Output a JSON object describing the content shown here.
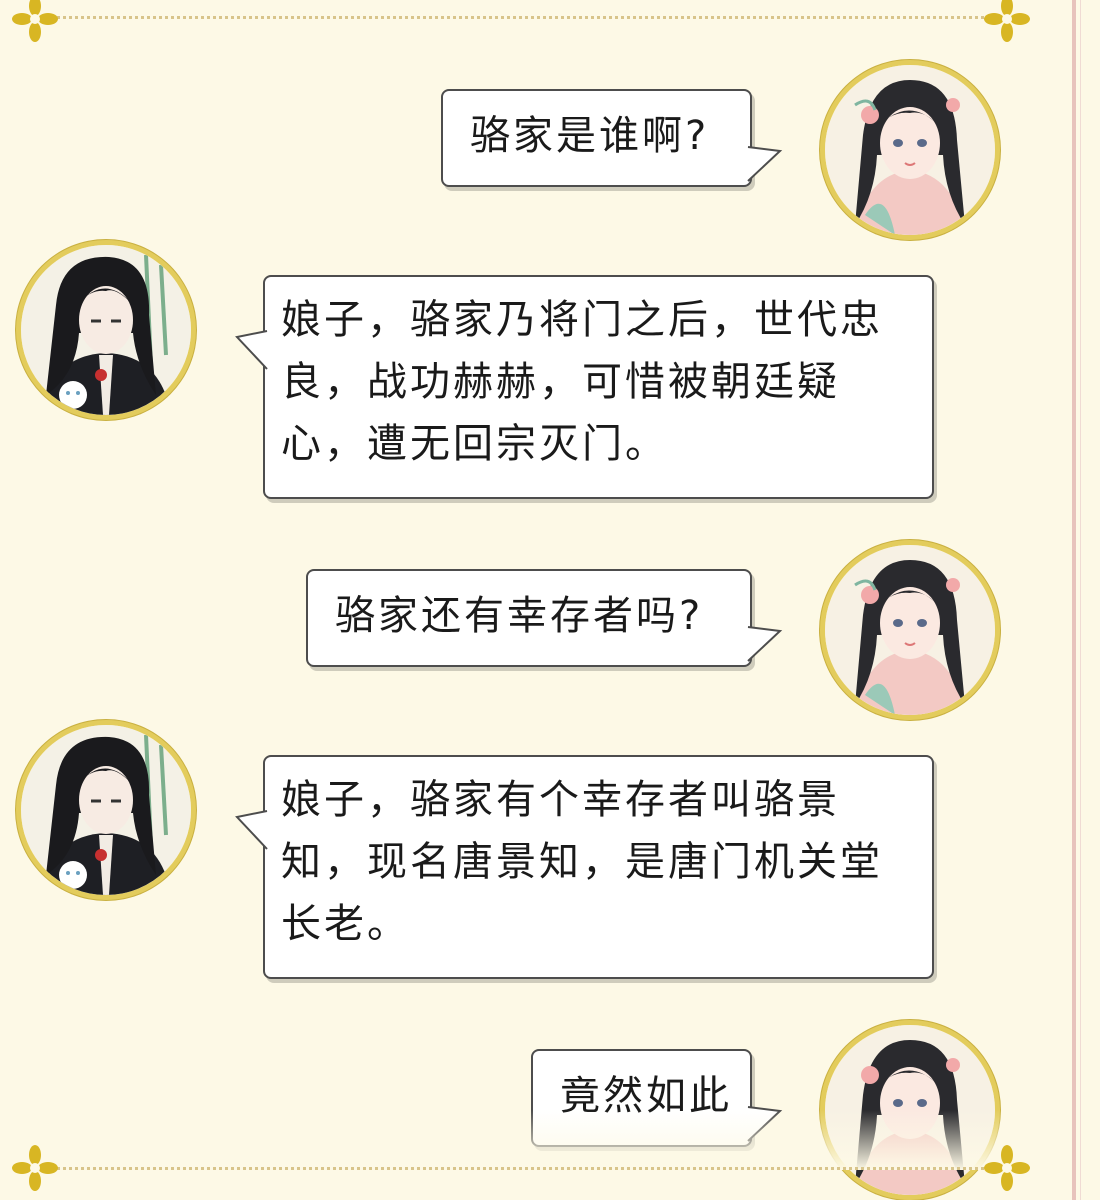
{
  "theme": {
    "background": "#fdf9e6",
    "avatar_ring": "#e3cc5c",
    "bubble_border": "#4d4d4d",
    "ornament": "#d8b623",
    "rule": "#e7c3bc"
  },
  "ornaments": {
    "corner_icon": "gold-flower-icon",
    "divider": "dotted-gold-line"
  },
  "participants": {
    "her": {
      "avatar_icon": "woman-portrait-icon",
      "side": "right"
    },
    "him": {
      "avatar_icon": "man-portrait-icon",
      "side": "left"
    }
  },
  "messages": [
    {
      "speaker": "her",
      "text": "骆家是谁啊?"
    },
    {
      "speaker": "him",
      "lines": [
        "娘子，骆家乃将门之后，世代忠",
        "良，战功赫赫，可惜被朝廷疑",
        "心，遭无回宗灭门。"
      ]
    },
    {
      "speaker": "her",
      "text": "骆家还有幸存者吗?"
    },
    {
      "speaker": "him",
      "lines": [
        "娘子，骆家有个幸存者叫骆景",
        "知，现名唐景知，是唐门机关堂",
        "长老。"
      ]
    },
    {
      "speaker": "her",
      "text": "竟然如此"
    }
  ]
}
